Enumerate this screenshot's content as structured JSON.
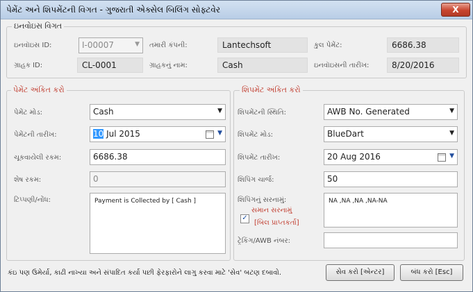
{
  "window": {
    "title": "પેમેંટ અને શિપમેંટની વિગત - ગુજરાતી એક્સેલ બિલિંગ સોફ્ટવેર",
    "close_label": "X"
  },
  "invoice": {
    "group_label": "ઇનવોઇસ વિગત",
    "invoice_id_label": "ઇનવૉઇસ ID:",
    "invoice_id_value": "I-00007",
    "company_label": "તમારી કંપની:",
    "company_value": "Lantechsoft",
    "total_label": "કુલ પેમેંટ:",
    "total_value": "6686.38",
    "customer_id_label": "ગ્રાહક ID:",
    "customer_id_value": "CL-0001",
    "customer_name_label": "ગ્રાહકનું નામ:",
    "customer_name_value": "Cash",
    "invoice_date_label": "ઇનવૉઇસની તારીખ:",
    "invoice_date_value": "8/20/2016"
  },
  "payment": {
    "group_label": "પેમેંટ અંકિત કરો",
    "mode_label": "પેમેંટ મોડ:",
    "mode_value": "Cash",
    "date_label": "પેમેંટની તારીખ:",
    "date_day": "10",
    "date_rest": " Jul  2015",
    "paid_label": "ચૂકવાયેલી રકમ:",
    "paid_value": "6686.38",
    "balance_label": "શેષ રકમ:",
    "balance_value": "0",
    "notes_label": "ટિપ્પણી/નોંધ:",
    "notes_value": "Payment is Collected by [ Cash ]"
  },
  "shipment": {
    "group_label": "શિપમેંટ અંકિત કરો",
    "status_label": "શિપમેંટની સ્થિતિ:",
    "status_value": "AWB No. Generated",
    "mode_label": "શિપમેંટ મોડ:",
    "mode_value": "BlueDart",
    "date_label": "શિપમેંટ તારીખ:",
    "date_value": "20 Aug 2016",
    "charge_label": "શિપિંગ ચાર્જ:",
    "charge_value": "50",
    "address_label": "શિપિંગનું સરનામું:",
    "address_value": "NA ,NA ,NA ,NA-NA",
    "same_address_line1": "સમાન સરનામું",
    "same_address_line2": "[બિલ પ્રાપ્તકર્તા]",
    "same_address_checked": "✓",
    "tracking_label": "ટ્રેકિંગ/AWB નંબર:",
    "tracking_value": ""
  },
  "footer": {
    "hint": "કંઇ પણ ઉમેર્યા, કાઢી નાખ્યા અને સંપાદિત કર્યા પછી ફેરફારોને લાગુ કરવા માટે 'સેવ' બટણ દબાવો.",
    "save_label": "સેવ કરો [એન્ટર]",
    "close_label": "બંધ કરો [Esc]"
  },
  "colors": {
    "section_red": "#c0392b",
    "selection": "#3399ff"
  },
  "icons": {
    "dropdown": "chevron-down-icon",
    "calendar": "calendar-icon"
  }
}
